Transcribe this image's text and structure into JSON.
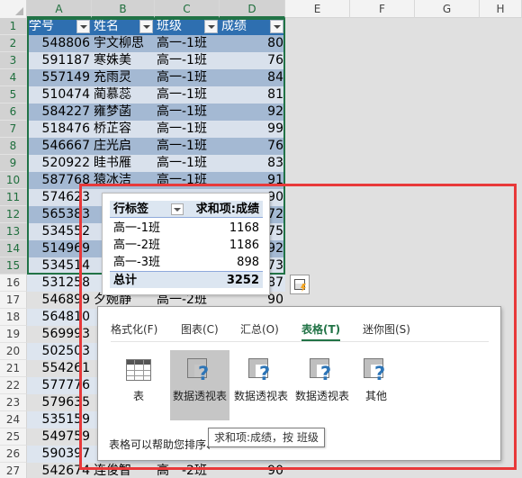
{
  "columns": [
    "A",
    "B",
    "C",
    "D",
    "E",
    "F",
    "G",
    "H"
  ],
  "table": {
    "headers": [
      "学号",
      "姓名",
      "班级",
      "成绩"
    ],
    "rows": [
      {
        "row": "2",
        "id": "548806",
        "name": "宇文柳思",
        "cls": "高一-1班",
        "score": "80"
      },
      {
        "row": "3",
        "id": "591187",
        "name": "寒姝美",
        "cls": "高一-1班",
        "score": "76"
      },
      {
        "row": "4",
        "id": "557149",
        "name": "充雨灵",
        "cls": "高一-1班",
        "score": "84"
      },
      {
        "row": "5",
        "id": "510474",
        "name": "蔺慕蕊",
        "cls": "高一-1班",
        "score": "81"
      },
      {
        "row": "6",
        "id": "584227",
        "name": "雍梦菡",
        "cls": "高一-1班",
        "score": "92"
      },
      {
        "row": "7",
        "id": "518476",
        "name": "桥芷容",
        "cls": "高一-1班",
        "score": "99"
      },
      {
        "row": "8",
        "id": "546667",
        "name": "庄光启",
        "cls": "高一-1班",
        "score": "76"
      },
      {
        "row": "9",
        "id": "520922",
        "name": "眭书雁",
        "cls": "高一-1班",
        "score": "83"
      },
      {
        "row": "10",
        "id": "587768",
        "name": "猿冰洁",
        "cls": "高一-1班",
        "score": "91"
      },
      {
        "row": "11",
        "id": "574623",
        "name": "",
        "cls": "",
        "score": "90"
      },
      {
        "row": "12",
        "id": "565383",
        "name": "",
        "cls": "",
        "score": "72"
      },
      {
        "row": "13",
        "id": "534552",
        "name": "",
        "cls": "",
        "score": "75"
      },
      {
        "row": "14",
        "id": "514969",
        "name": "",
        "cls": "",
        "score": "92"
      },
      {
        "row": "15",
        "id": "534514",
        "name": "",
        "cls": "",
        "score": "73"
      },
      {
        "row": "16",
        "id": "531258",
        "name": "",
        "cls": "",
        "score": "87"
      },
      {
        "row": "17",
        "id": "546899",
        "name": "夕婉静",
        "cls": "高一-2班",
        "score": "90"
      },
      {
        "row": "18",
        "id": "564810",
        "name": "",
        "cls": "",
        "score": ""
      },
      {
        "row": "19",
        "id": "569993",
        "name": "",
        "cls": "",
        "score": ""
      },
      {
        "row": "20",
        "id": "502503",
        "name": "",
        "cls": "",
        "score": ""
      },
      {
        "row": "21",
        "id": "554261",
        "name": "",
        "cls": "",
        "score": ""
      },
      {
        "row": "22",
        "id": "577776",
        "name": "",
        "cls": "",
        "score": ""
      },
      {
        "row": "23",
        "id": "579635",
        "name": "",
        "cls": "",
        "score": ""
      },
      {
        "row": "24",
        "id": "535159",
        "name": "",
        "cls": "",
        "score": ""
      },
      {
        "row": "25",
        "id": "549759",
        "name": "",
        "cls": "",
        "score": ""
      },
      {
        "row": "26",
        "id": "590397",
        "name": "",
        "cls": "",
        "score": ""
      },
      {
        "row": "27",
        "id": "542674",
        "name": "连俊智",
        "cls": "高一-2班",
        "score": "90"
      }
    ]
  },
  "pivot": {
    "header_label": "行标签",
    "header_value": "求和项:成绩",
    "rows": [
      {
        "label": "高一-1班",
        "value": "1168"
      },
      {
        "label": "高一-2班",
        "value": "1186"
      },
      {
        "label": "高一-3班",
        "value": "898"
      }
    ],
    "total_label": "总计",
    "total_value": "3252"
  },
  "quick_analysis": {
    "tabs": [
      "格式化(F)",
      "图表(C)",
      "汇总(O)",
      "表格(T)",
      "迷你图(S)"
    ],
    "active_tab": "表格(T)",
    "items": [
      "表",
      "数据透视表",
      "数据透视表",
      "数据透视表",
      "其他"
    ],
    "footer": "表格可以帮助您排序、",
    "tooltip": "求和项:成绩，按 班级"
  },
  "colors": {
    "header_band": "#2e6fb0",
    "band_dark": "#a4b9d3",
    "band_light": "#d9e1ec",
    "selection": "#217346",
    "annotation_red": "#e8393a"
  }
}
